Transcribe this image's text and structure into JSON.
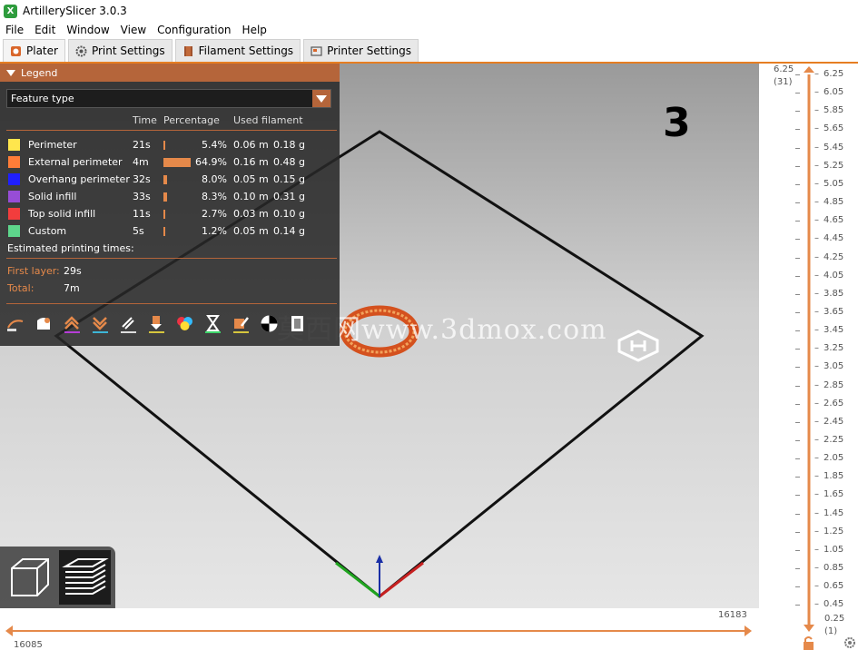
{
  "window": {
    "title": "ArtillerySlicer 3.0.3",
    "app_icon_glyph": "X"
  },
  "menu": [
    "File",
    "Edit",
    "Window",
    "View",
    "Configuration",
    "Help"
  ],
  "tabs": [
    {
      "label": "Plater",
      "icon": "plater-icon",
      "active": true
    },
    {
      "label": "Print Settings",
      "icon": "gear-icon",
      "active": false
    },
    {
      "label": "Filament Settings",
      "icon": "spool-icon",
      "active": false
    },
    {
      "label": "Printer Settings",
      "icon": "printer-icon",
      "active": false
    }
  ],
  "legend": {
    "title": "Legend",
    "view_type": "Feature type",
    "columns": {
      "time": "Time",
      "percentage": "Percentage",
      "used_filament": "Used filament"
    },
    "features": [
      {
        "name": "Perimeter",
        "color": "#ffe64d",
        "time": "21s",
        "percent": "5.4%",
        "pct_value": 5.4,
        "length": "0.06 m",
        "weight": "0.18 g"
      },
      {
        "name": "External perimeter",
        "color": "#ff7d38",
        "time": "4m",
        "percent": "64.9%",
        "pct_value": 64.9,
        "length": "0.16 m",
        "weight": "0.48 g"
      },
      {
        "name": "Overhang perimeter",
        "color": "#1f1fff",
        "time": "32s",
        "percent": "8.0%",
        "pct_value": 8.0,
        "length": "0.05 m",
        "weight": "0.15 g"
      },
      {
        "name": "Solid infill",
        "color": "#974dd6",
        "time": "33s",
        "percent": "8.3%",
        "pct_value": 8.3,
        "length": "0.10 m",
        "weight": "0.31 g"
      },
      {
        "name": "Top solid infill",
        "color": "#f23d3d",
        "time": "11s",
        "percent": "2.7%",
        "pct_value": 2.7,
        "length": "0.03 m",
        "weight": "0.10 g"
      },
      {
        "name": "Custom",
        "color": "#5ed68c",
        "time": "5s",
        "percent": "1.2%",
        "pct_value": 1.2,
        "length": "0.05 m",
        "weight": "0.14 g"
      }
    ],
    "estimated_label": "Estimated printing times:",
    "first_layer_label": "First layer:",
    "first_layer_value": "29s",
    "total_label": "Total:",
    "total_value": "7m",
    "toolbar_icons": [
      "travel-icon",
      "wipe-icon",
      "retraction-icon",
      "deretraction-icon",
      "seam-icon",
      "tool-change-icon",
      "color-change-icon",
      "pause-icon",
      "custom-gcode-icon",
      "center-of-gravity-icon",
      "shells-icon"
    ]
  },
  "viewport": {
    "layer_number": "3",
    "watermark": "莫西网www.3dmox.com"
  },
  "vertical_slider": {
    "top_value": "6.25",
    "top_layer": "(31)",
    "bottom_value": "0.25",
    "bottom_layer": "(1)",
    "ticks": [
      "6.25",
      "6.05",
      "5.85",
      "5.65",
      "5.45",
      "5.25",
      "5.05",
      "4.85",
      "4.65",
      "4.45",
      "4.25",
      "4.05",
      "3.85",
      "3.65",
      "3.45",
      "3.25",
      "3.05",
      "2.85",
      "2.65",
      "2.45",
      "2.25",
      "2.05",
      "1.85",
      "1.65",
      "1.45",
      "1.25",
      "1.05",
      "0.85",
      "0.65",
      "0.45"
    ]
  },
  "horizontal_slider": {
    "right_value": "16183",
    "left_value": "16085"
  },
  "colors": {
    "accent": "#e67e22",
    "legend_header": "#b5653a"
  }
}
